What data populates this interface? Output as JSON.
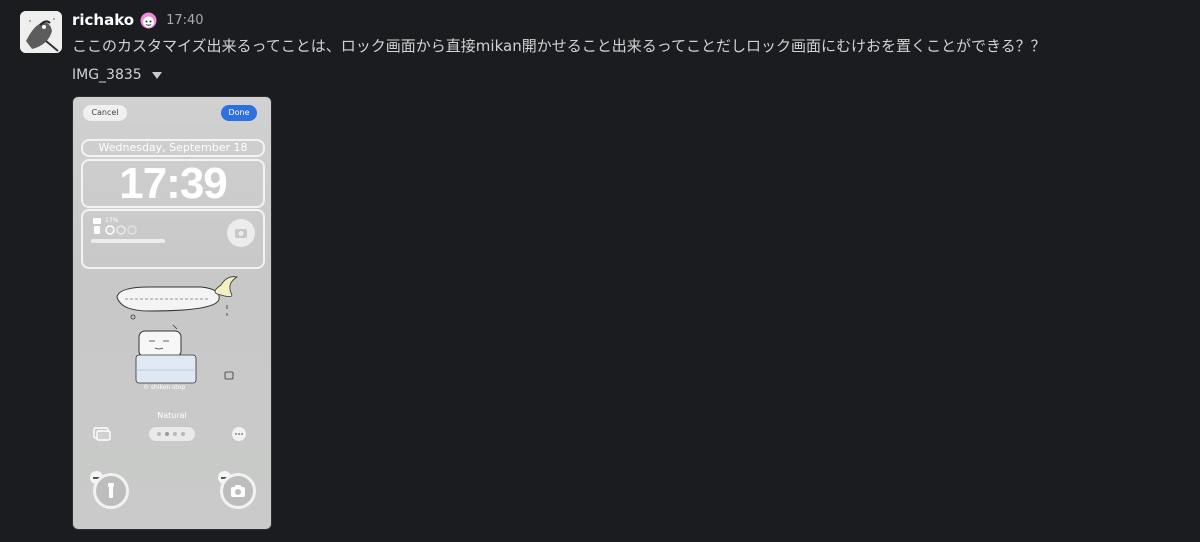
{
  "message": {
    "author": "richako",
    "time": "17:40",
    "text": "ここのカスタマイズ出来るってことは、ロック画面から直接mikan開かせること出来るってことだしロック画面にむけおを置くことができる？？",
    "status_icon": "pink-face-emoji",
    "avatar_icon": "bird-avatar"
  },
  "attachment": {
    "file_name": "IMG_3835",
    "toggle_icon": "caret-down-icon"
  },
  "phone": {
    "cancel_label": "Cancel",
    "done_label": "Done",
    "date": "Wednesday, September 18",
    "clock": "17:39",
    "battery_pct": "17%",
    "wallpaper_name": "Natural",
    "credit": "© shiken.stop",
    "colors": {
      "done_button": "#2f6fe0",
      "background": "#1b1c1f"
    }
  }
}
